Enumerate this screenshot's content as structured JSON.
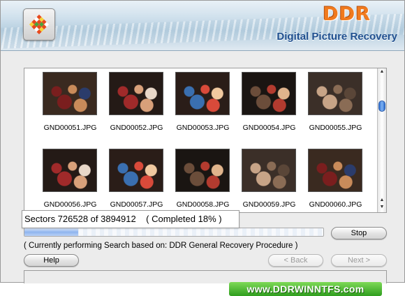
{
  "header": {
    "brand": "DDR",
    "product": "Digital Picture Recovery"
  },
  "gallery": {
    "items": [
      {
        "name": "GND00051.JPG",
        "icon": "party-photo"
      },
      {
        "name": "GND00052.JPG",
        "icon": "party-photo"
      },
      {
        "name": "GND00053.JPG",
        "icon": "party-photo"
      },
      {
        "name": "GND00054.JPG",
        "icon": "party-photo"
      },
      {
        "name": "GND00055.JPG",
        "icon": "party-photo"
      },
      {
        "name": "GND00056.JPG",
        "icon": "party-photo"
      },
      {
        "name": "GND00057.JPG",
        "icon": "party-photo"
      },
      {
        "name": "GND00058.JPG",
        "icon": "party-photo"
      },
      {
        "name": "GND00059.JPG",
        "icon": "party-photo"
      },
      {
        "name": "GND00060.JPG",
        "icon": "party-photo"
      }
    ]
  },
  "progress": {
    "sectors_text": "Sectors 726528 of 3894912    ( Completed 18% )",
    "fraction": 0.18,
    "status_text": "( Currently performing Search based on: DDR General Recovery Procedure )"
  },
  "buttons": {
    "stop": "Stop",
    "help": "Help",
    "back": "< Back",
    "next": "Next >"
  },
  "footer": {
    "url": "www.DDRWINNTFS.com"
  },
  "colors": {
    "brand_orange": "#f07a1e",
    "product_blue": "#1f4f8f",
    "scroll_blue": "#2f6fd1",
    "badge_green": "#2f9d1e"
  }
}
